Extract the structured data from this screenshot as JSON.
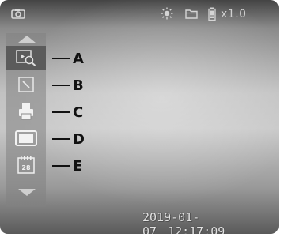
{
  "status_bar": {
    "zoom_level": "x1.0",
    "icons": [
      "camera-icon",
      "brightness-icon",
      "folder-icon",
      "battery-icon"
    ]
  },
  "menu": {
    "items": [
      {
        "icon": "playback-zoom-icon",
        "callout": "A",
        "selected": true
      },
      {
        "icon": "edit-icon",
        "callout": "B",
        "selected": false
      },
      {
        "icon": "print-icon",
        "callout": "C",
        "selected": false
      },
      {
        "icon": "photo-frame-icon",
        "callout": "D",
        "selected": false
      },
      {
        "icon": "date-stamp-icon",
        "callout": "E",
        "selected": false
      }
    ],
    "date_icon_text": "28"
  },
  "footer": {
    "date": "2019-01-07",
    "time": "12:17:09"
  }
}
